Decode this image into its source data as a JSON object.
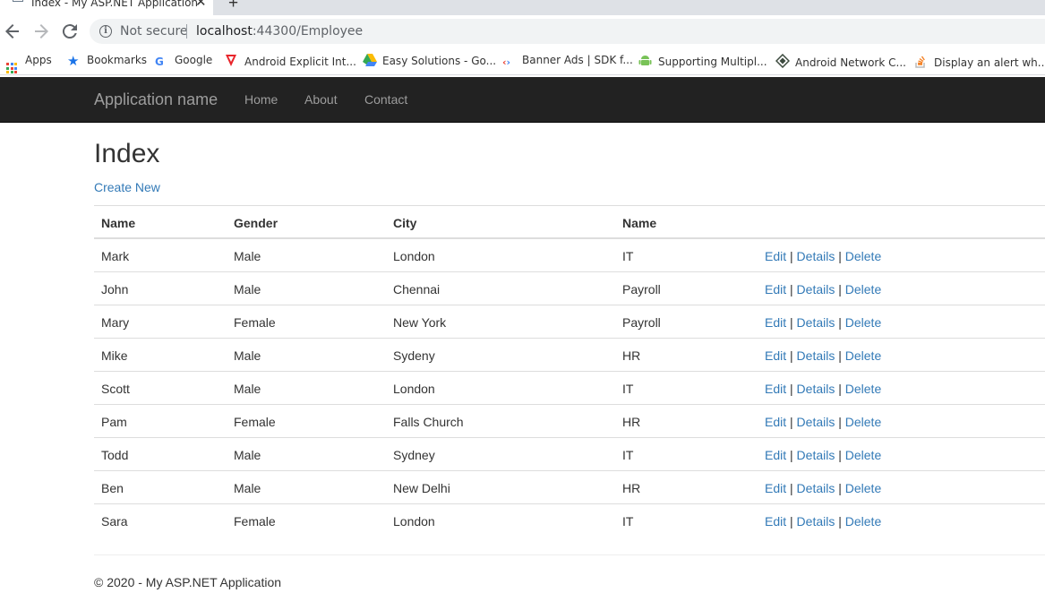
{
  "browser": {
    "tab_title": "Index - My ASP.NET Application",
    "security_label": "Not secure",
    "url_host": "localhost",
    "url_rest": ":44300/Employee",
    "bookmarks": [
      {
        "label": "Apps",
        "icon": "apps-grid-icon"
      },
      {
        "label": "Bookmarks",
        "icon": "star-icon"
      },
      {
        "label": "Google",
        "icon": "google-icon"
      },
      {
        "label": "Android Explicit Int...",
        "icon": "vivaldi-icon"
      },
      {
        "label": "Easy Solutions - Go...",
        "icon": "drive-icon"
      },
      {
        "label": "Banner Ads  |  SDK f...",
        "icon": "admob-icon"
      },
      {
        "label": "Supporting Multipl...",
        "icon": "android-icon"
      },
      {
        "label": "Android Network C...",
        "icon": "network-icon"
      },
      {
        "label": "Display an alert wh...",
        "icon": "stackoverflow-icon"
      }
    ]
  },
  "navbar": {
    "brand": "Application name",
    "links": [
      "Home",
      "About",
      "Contact"
    ]
  },
  "page": {
    "title": "Index",
    "create_new": "Create New"
  },
  "table": {
    "columns": [
      "Name",
      "Gender",
      "City",
      "Name"
    ],
    "actions": {
      "edit": "Edit",
      "details": "Details",
      "delete": "Delete",
      "separator": "|"
    },
    "rows": [
      {
        "name": "Mark",
        "gender": "Male",
        "city": "London",
        "dept": "IT"
      },
      {
        "name": "John",
        "gender": "Male",
        "city": "Chennai",
        "dept": "Payroll"
      },
      {
        "name": "Mary",
        "gender": "Female",
        "city": "New York",
        "dept": "Payroll"
      },
      {
        "name": "Mike",
        "gender": "Male",
        "city": "Sydeny",
        "dept": "HR"
      },
      {
        "name": "Scott",
        "gender": "Male",
        "city": "London",
        "dept": "IT"
      },
      {
        "name": "Pam",
        "gender": "Female",
        "city": "Falls Church",
        "dept": "HR"
      },
      {
        "name": "Todd",
        "gender": "Male",
        "city": "Sydney",
        "dept": "IT"
      },
      {
        "name": "Ben",
        "gender": "Male",
        "city": "New Delhi",
        "dept": "HR"
      },
      {
        "name": "Sara",
        "gender": "Female",
        "city": "London",
        "dept": "IT"
      }
    ]
  },
  "footer": "© 2020 - My ASP.NET Application",
  "colors": {
    "link": "#337ab7",
    "navbar": "#222222",
    "nav_text": "#9d9d9d"
  }
}
